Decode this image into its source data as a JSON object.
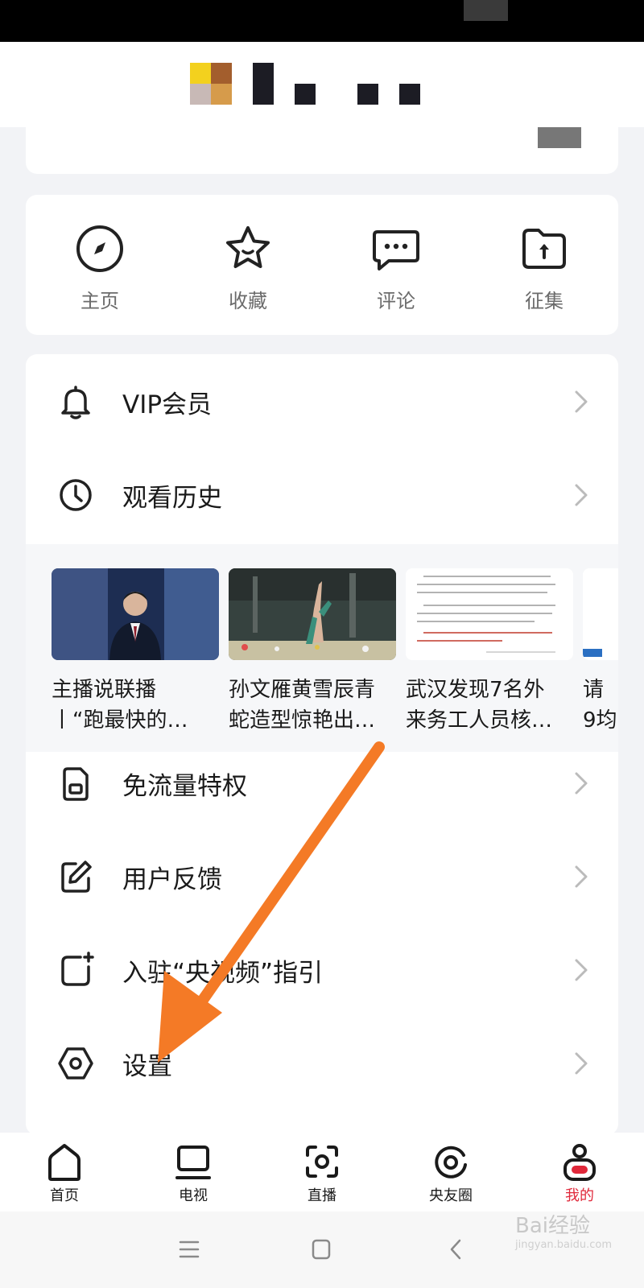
{
  "quick_actions": [
    {
      "label": "主页",
      "icon": "compass-icon"
    },
    {
      "label": "收藏",
      "icon": "star-icon"
    },
    {
      "label": "评论",
      "icon": "comment-icon"
    },
    {
      "label": "征集",
      "icon": "upload-folder-icon"
    }
  ],
  "menu": {
    "vip": "VIP会员",
    "history": "观看历史",
    "data_free": "免流量特权",
    "feedback": "用户反馈",
    "creator": "入驻“央视频”指引",
    "settings": "设置"
  },
  "history_items": [
    {
      "caption_line1": "主播说联播",
      "caption_line2": "丨“跑最快的…"
    },
    {
      "caption_line1": "孙文雁黄雪辰青",
      "caption_line2": "蛇造型惊艳出…"
    },
    {
      "caption_line1": "武汉发现7名外",
      "caption_line2": "来务工人员核…"
    },
    {
      "caption_line1": "请",
      "caption_line2": "9均"
    }
  ],
  "tabs": [
    {
      "label": "首页",
      "icon": "home-icon"
    },
    {
      "label": "电视",
      "icon": "tv-icon"
    },
    {
      "label": "直播",
      "icon": "live-icon"
    },
    {
      "label": "央友圈",
      "icon": "circle-icon"
    },
    {
      "label": "我的",
      "icon": "profile-icon",
      "active": true
    }
  ],
  "watermark": {
    "main": "Bai经验",
    "sub": "jingyan.baidu.com"
  },
  "colors": {
    "accent": "#e0283a",
    "arrow": "#f47a26",
    "background": "#f2f3f6"
  }
}
